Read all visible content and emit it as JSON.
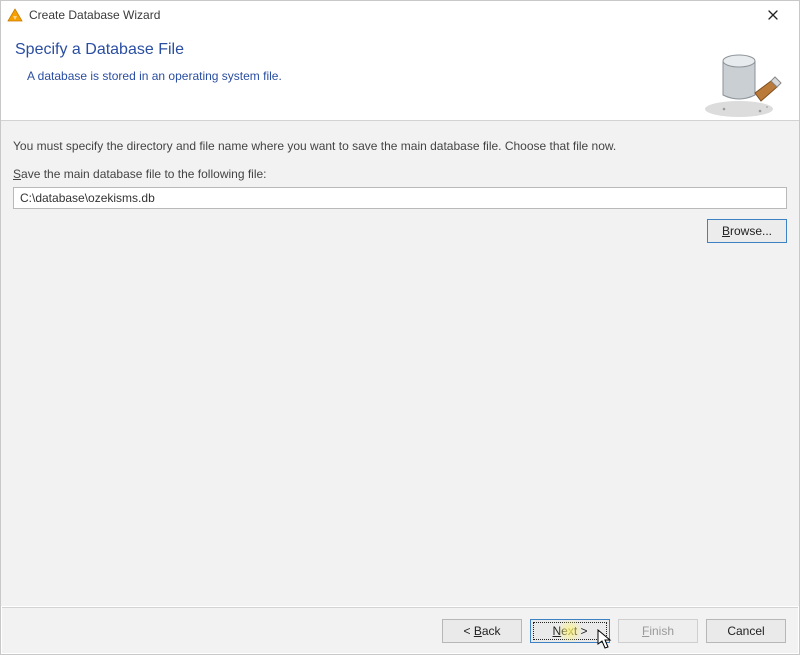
{
  "window": {
    "title": "Create Database Wizard"
  },
  "header": {
    "heading": "Specify a Database File",
    "subtitle": "A database is stored in an operating system file."
  },
  "body": {
    "instruction": "You must specify the directory and file name where you want to save the main database file. Choose that file now.",
    "file_label_prefix": "S",
    "file_label_rest": "ave the main database file to the following file:",
    "file_path": "C:\\database\\ozekisms.db",
    "browse_prefix": "B",
    "browse_rest": "rowse..."
  },
  "footer": {
    "back_prefix": "< ",
    "back_mnemonic": "B",
    "back_rest": "ack",
    "next_prefix": "N",
    "next_rest": "ext >",
    "finish_prefix": "F",
    "finish_rest": "inish",
    "cancel": "Cancel"
  }
}
